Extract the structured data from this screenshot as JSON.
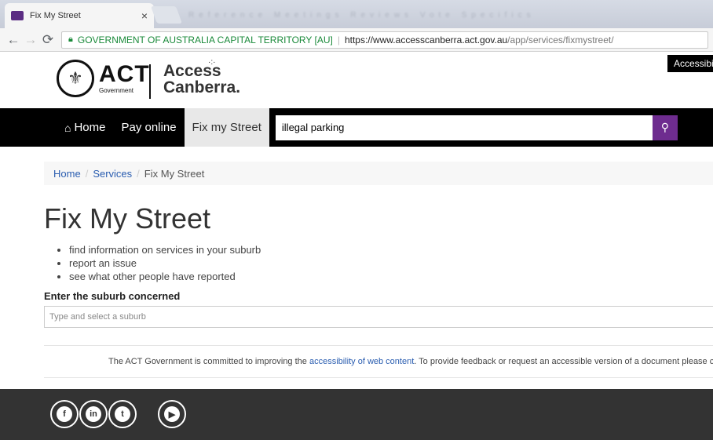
{
  "browser": {
    "tab_title": "Fix My Street",
    "tab_close": "×",
    "blurred_tabs": "Reference Meetings Reviews Vote Specifics",
    "address": {
      "secure_label": "GOVERNMENT OF AUSTRALIA CAPITAL TERRITORY [AU]",
      "url_host": "https://www.accesscanberra.act.gov.au",
      "url_path": "/app/services/fixmystreet/"
    }
  },
  "header": {
    "act_big": "ACT",
    "act_small": "Government",
    "access_line1": "Access",
    "access_line2": "Canberra.",
    "accessibility_label": "Accessibility"
  },
  "nav": {
    "home": "Home",
    "pay_online": "Pay online",
    "fix_my_street": "Fix my Street",
    "search_value": "illegal parking"
  },
  "breadcrumb": {
    "home": "Home",
    "services": "Services",
    "current": "Fix My Street"
  },
  "main": {
    "title": "Fix My Street",
    "bullets": [
      "find information on services in your suburb",
      "report an issue",
      "see what other people have reported"
    ],
    "suburb_label": "Enter the suburb concerned",
    "suburb_placeholder": "Type and select a suburb",
    "notice_before": "The ACT Government is committed to improving the ",
    "notice_link": "accessibility of web content",
    "notice_after": ". To provide feedback or request an accessible version of a document please contact"
  },
  "footer": {
    "social": [
      "facebook-icon",
      "linkedin-icon",
      "twitter-icon",
      "youtube-icon"
    ]
  },
  "colors": {
    "search_button": "#6e2c8f",
    "nav_bg": "#000000",
    "footer_bg": "#333333",
    "link": "#2a5db0"
  }
}
